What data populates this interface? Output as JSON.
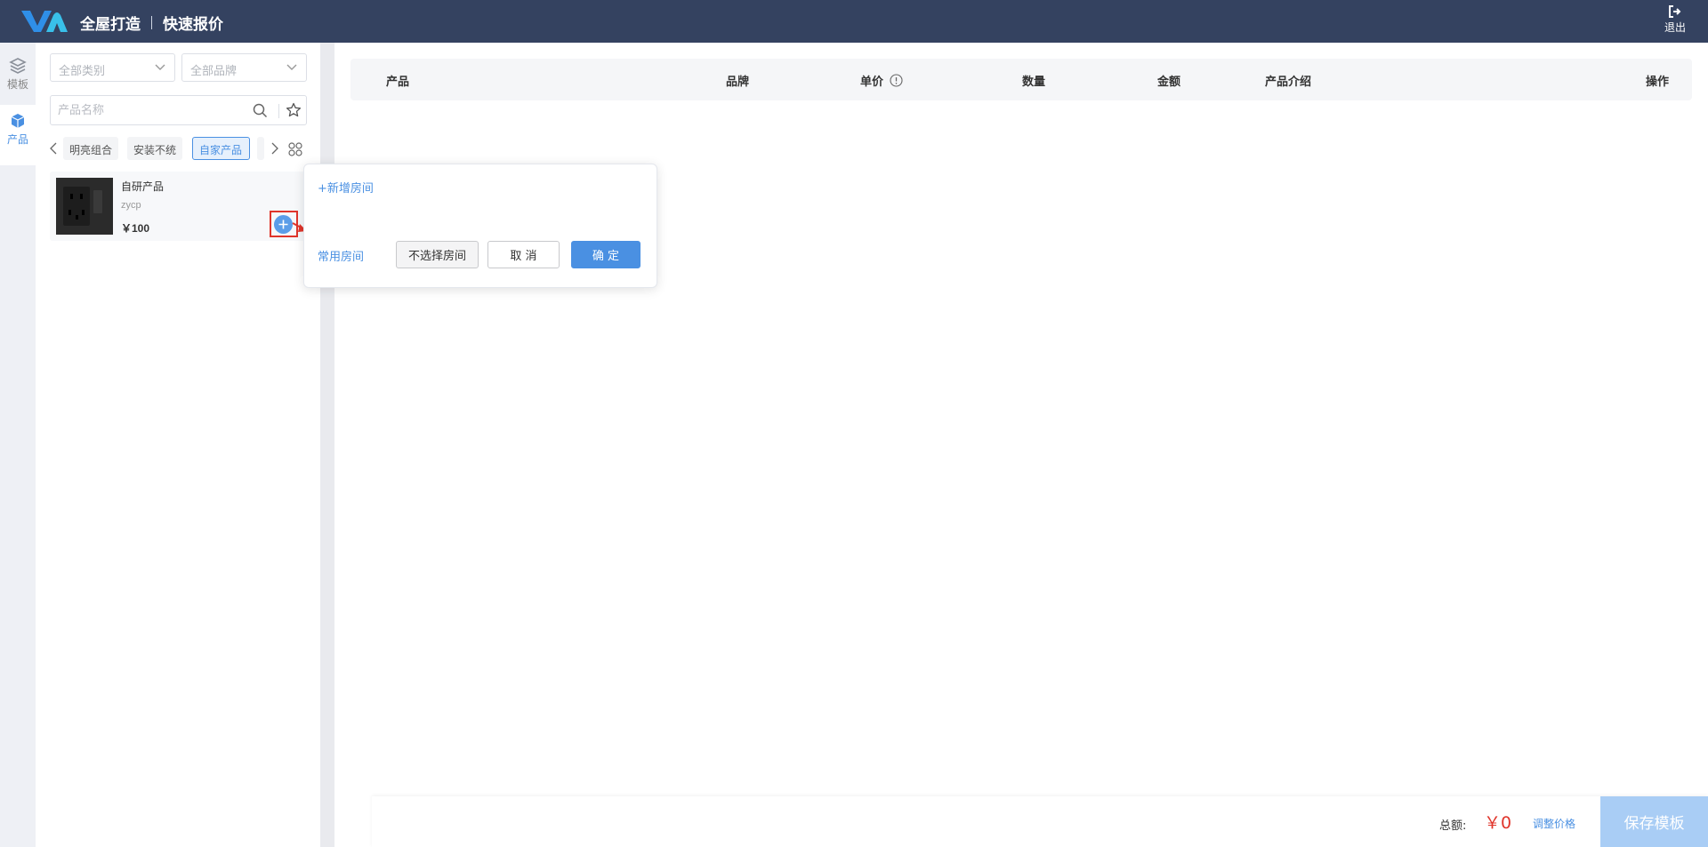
{
  "header": {
    "title_main": "全屋打造",
    "title_sub": "快速报价",
    "logout_label": "退出"
  },
  "rail": {
    "models_label": "模板",
    "products_label": "产品"
  },
  "filters": {
    "category_placeholder": "全部类别",
    "brand_placeholder": "全部品牌",
    "search_placeholder": "产品名称"
  },
  "tabs": [
    {
      "label": "明亮组合"
    },
    {
      "label": "安装不统"
    },
    {
      "label": "自家产品",
      "active": true
    }
  ],
  "product": {
    "name": "自研产品",
    "code": "zycp",
    "price": "￥100"
  },
  "popover": {
    "add_room": "+新增房间",
    "common_rooms": "常用房间",
    "no_room_button": "不选择房间",
    "cancel_button": "取 消",
    "ok_button": "确 定"
  },
  "table": {
    "columns": [
      "产品",
      "品牌",
      "单价",
      "数量",
      "金额",
      "产品介绍",
      "操作"
    ]
  },
  "footer": {
    "total_label": "总额:",
    "total_value": "￥0",
    "adjust_price": "调整价格",
    "save_button": "保存模板"
  },
  "colors": {
    "header_bg": "#344260",
    "accent": "#4a90e2",
    "danger": "#e0352b"
  }
}
